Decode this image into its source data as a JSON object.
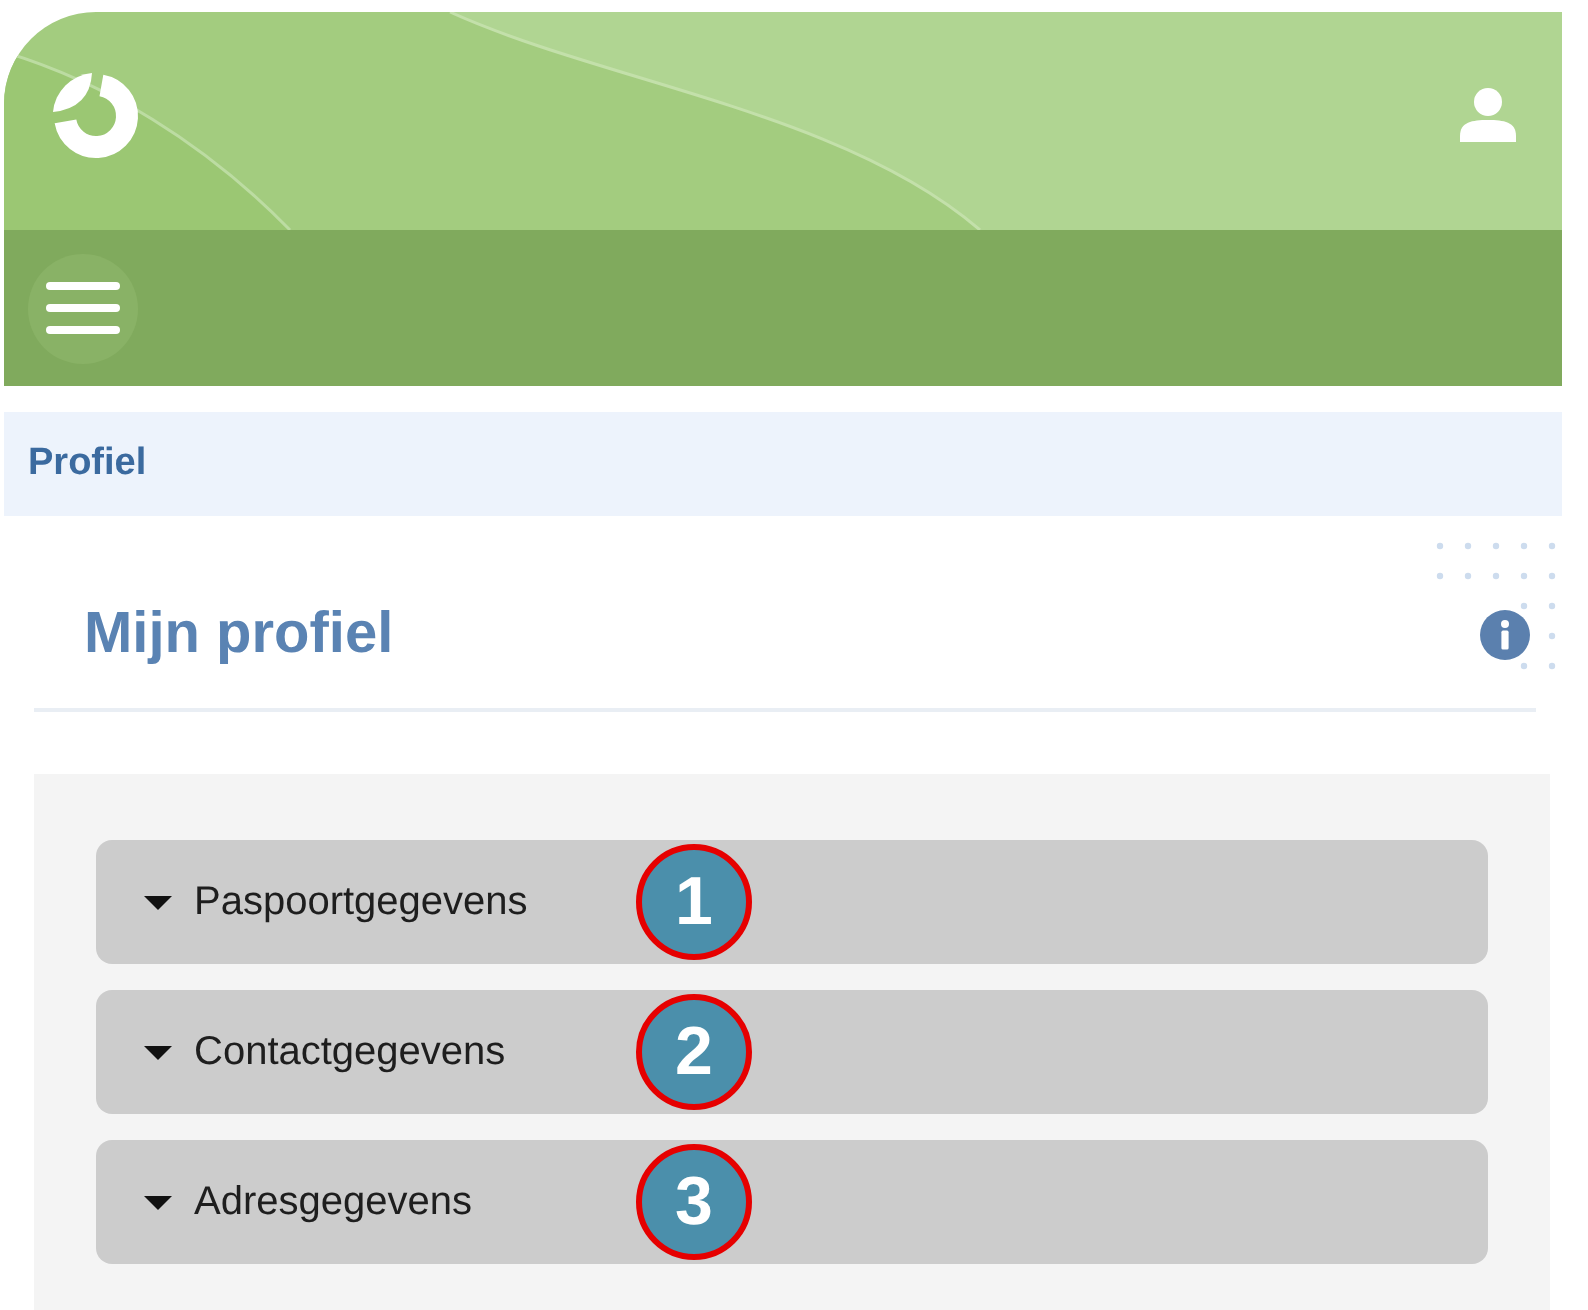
{
  "breadcrumb": {
    "label": "Profiel"
  },
  "page": {
    "title": "Mijn profiel"
  },
  "sections": [
    {
      "label": "Paspoortgegevens",
      "badge": "1"
    },
    {
      "label": "Contactgegevens",
      "badge": "2"
    },
    {
      "label": "Adresgegevens",
      "badge": "3"
    }
  ]
}
